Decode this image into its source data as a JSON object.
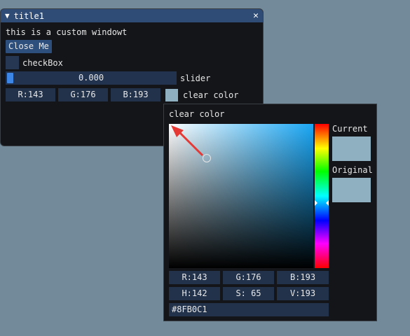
{
  "window": {
    "title": "title1",
    "collapse_glyph": "▼",
    "close_glyph": "✕",
    "text_line": "this is a custom windowt",
    "close_button_label": "Close Me",
    "checkbox_label": "checkBox",
    "checkbox_checked": false,
    "slider_value": "0.000",
    "slider_fraction": 0.0,
    "slider_label": "slider",
    "rgb_fields": [
      "R:143",
      "G:176",
      "B:193"
    ],
    "color_label": "clear color"
  },
  "picker": {
    "title": "clear color",
    "sv_cursor": {
      "saturation": 0.26,
      "value": 0.76
    },
    "hue_fraction": 0.55,
    "current_label": "Current",
    "original_label": "Original",
    "rgb": [
      "R:143",
      "G:176",
      "B:193"
    ],
    "hsv": [
      "H:142",
      "S: 65",
      "V:193"
    ],
    "hex": "#8FB0C1"
  },
  "colors": {
    "background": "#728a99",
    "title_bar": "#2f4c76",
    "button": "#2d4f7d",
    "field": "#22324b",
    "accent_blue": "#3d86e6",
    "selected_color": "#8fb0c1",
    "annotation_arrow": "#e53935"
  },
  "icons": {
    "collapse": "triangle-down-icon",
    "close": "close-icon",
    "annotation": "red-arrow"
  }
}
